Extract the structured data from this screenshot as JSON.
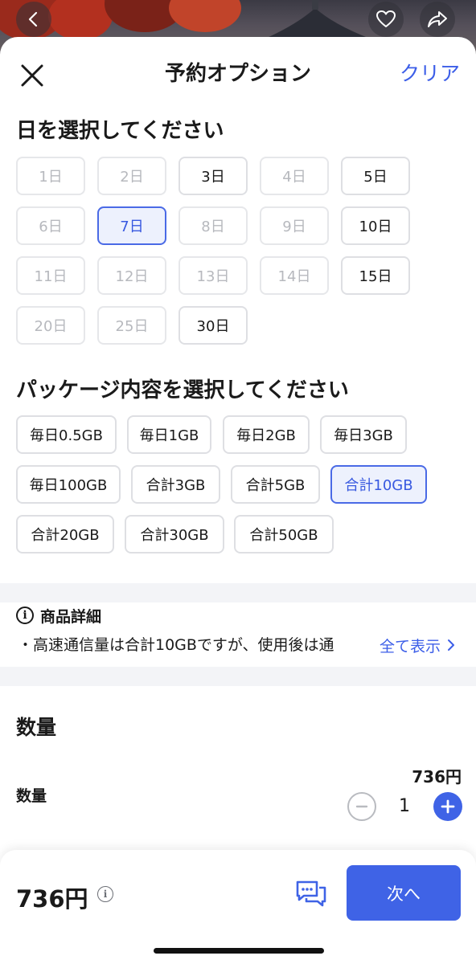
{
  "header": {
    "title": "予約オプション",
    "clear_label": "クリア"
  },
  "days": {
    "heading": "日を選択してください",
    "options": [
      {
        "label": "1日",
        "state": "disabled"
      },
      {
        "label": "2日",
        "state": "disabled"
      },
      {
        "label": "3日",
        "state": "enabled"
      },
      {
        "label": "4日",
        "state": "disabled"
      },
      {
        "label": "5日",
        "state": "enabled"
      },
      {
        "label": "6日",
        "state": "disabled"
      },
      {
        "label": "7日",
        "state": "selected"
      },
      {
        "label": "8日",
        "state": "disabled"
      },
      {
        "label": "9日",
        "state": "disabled"
      },
      {
        "label": "10日",
        "state": "enabled"
      },
      {
        "label": "11日",
        "state": "disabled"
      },
      {
        "label": "12日",
        "state": "disabled"
      },
      {
        "label": "13日",
        "state": "disabled"
      },
      {
        "label": "14日",
        "state": "disabled"
      },
      {
        "label": "15日",
        "state": "enabled"
      },
      {
        "label": "20日",
        "state": "disabled"
      },
      {
        "label": "25日",
        "state": "disabled"
      },
      {
        "label": "30日",
        "state": "enabled"
      }
    ]
  },
  "packages": {
    "heading": "パッケージ内容を選択してください",
    "options": [
      {
        "label": "毎日0.5GB",
        "state": "enabled"
      },
      {
        "label": "毎日1GB",
        "state": "enabled"
      },
      {
        "label": "毎日2GB",
        "state": "enabled"
      },
      {
        "label": "毎日3GB",
        "state": "enabled"
      },
      {
        "label": "毎日100GB",
        "state": "enabled"
      },
      {
        "label": "合計3GB",
        "state": "enabled"
      },
      {
        "label": "合計5GB",
        "state": "enabled"
      },
      {
        "label": "合計10GB",
        "state": "selected"
      },
      {
        "label": "合計20GB",
        "state": "enabled"
      },
      {
        "label": "合計30GB",
        "state": "enabled"
      },
      {
        "label": "合計50GB",
        "state": "enabled"
      }
    ]
  },
  "details": {
    "title": "商品詳細",
    "text": "・高速通信量は合計10GBですが、使用後は通",
    "show_all": "全て表示"
  },
  "quantity": {
    "section_title": "数量",
    "label": "数量",
    "unit_price": "736円",
    "value": "1"
  },
  "footer": {
    "total": "736円",
    "next_label": "次へ"
  },
  "icons": {
    "back": "chevron-left-icon",
    "favorite": "heart-icon",
    "share": "share-icon",
    "close": "close-icon",
    "info": "info-icon",
    "chevron": "chevron-right-icon",
    "minus": "minus-circle-icon",
    "plus": "plus-circle-icon",
    "chat": "chat-icon"
  },
  "colors": {
    "accent": "#3f63e6",
    "link": "#3c5ee8",
    "selected_bg": "#edf1fd",
    "selected_border": "#4a6ae6",
    "disabled_text": "#b7b9be"
  }
}
